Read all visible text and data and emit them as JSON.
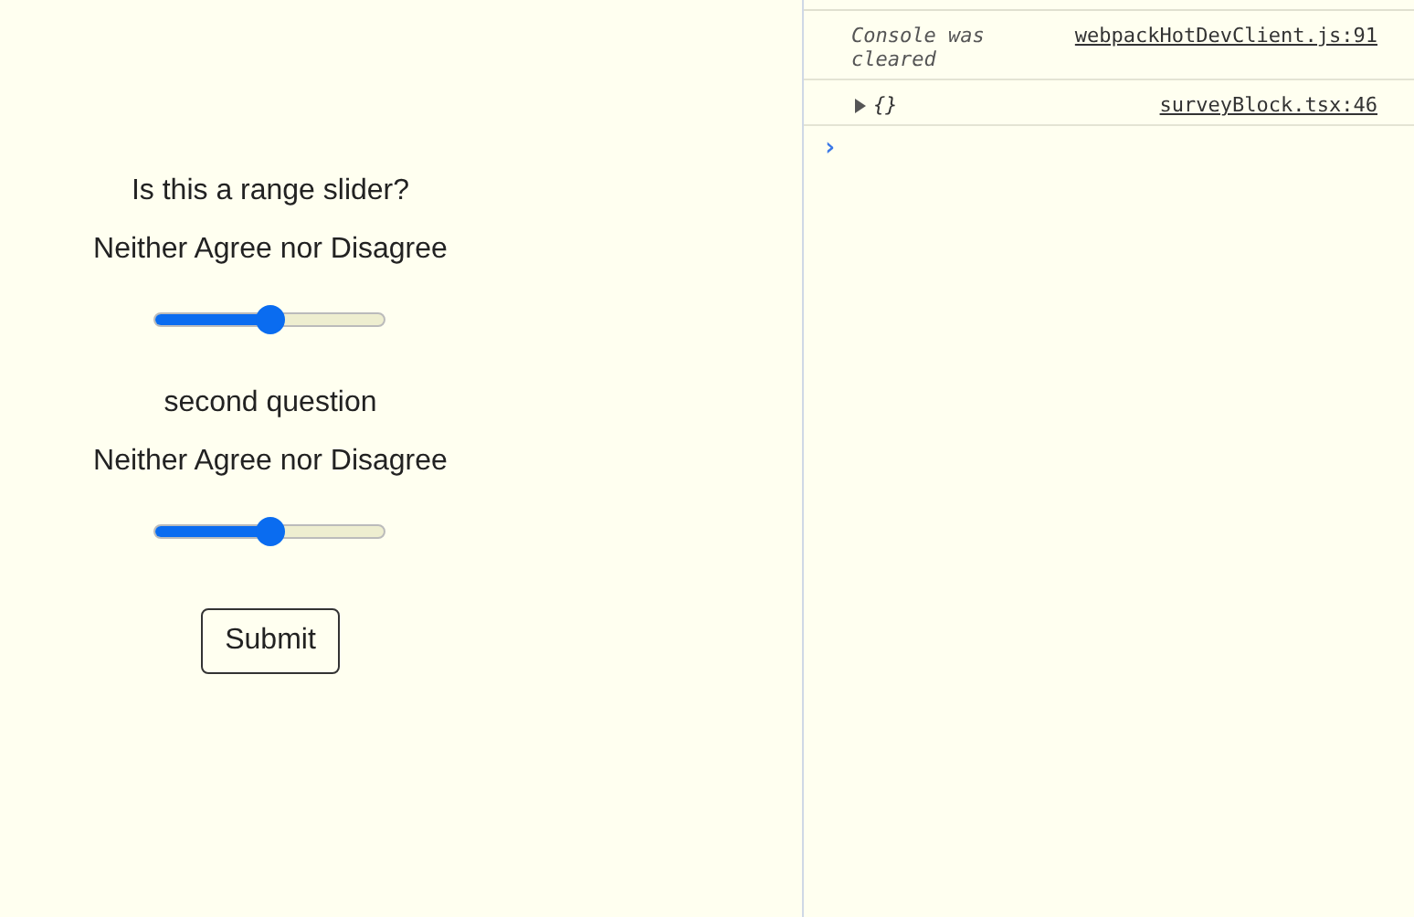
{
  "survey": {
    "questions": [
      {
        "prompt": "Is this a range slider?",
        "reading": "Neither Agree nor Disagree",
        "level": 0.5
      },
      {
        "prompt": "second question",
        "reading": "Neither Agree nor Disagree",
        "level": 0.5
      }
    ],
    "submit": "Submit"
  },
  "console": {
    "messages": [
      {
        "kind": "info",
        "text": "Console was cleared",
        "source": "webpackHotDevClient.js:91"
      },
      {
        "kind": "object",
        "expanded": false,
        "text": "{}",
        "source": "surveyBlock.tsx:46"
      }
    ],
    "prompt": "›"
  }
}
